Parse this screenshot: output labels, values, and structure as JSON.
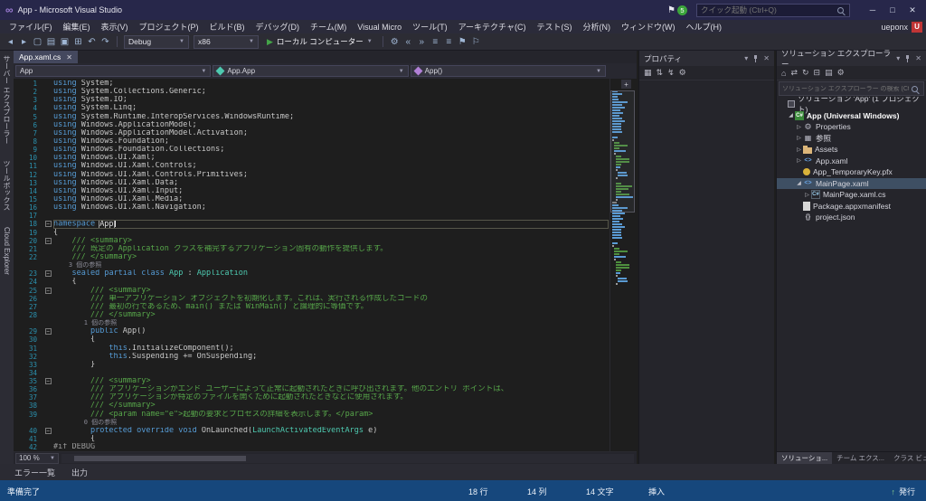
{
  "title_bar": {
    "title": "App - Microsoft Visual Studio",
    "notifications_count": "5",
    "quick_launch_placeholder": "クイック起動 (Ctrl+Q)"
  },
  "menu_bar": {
    "items": [
      "ファイル(F)",
      "編集(E)",
      "表示(V)",
      "プロジェクト(P)",
      "ビルド(B)",
      "デバッグ(D)",
      "チーム(M)",
      "Visual Micro",
      "ツール(T)",
      "アーキテクチャ(C)",
      "テスト(S)",
      "分析(N)",
      "ウィンドウ(W)",
      "ヘルプ(H)"
    ],
    "user_name": "ueponx",
    "user_avatar_letter": "U"
  },
  "toolbar": {
    "icons_left": [
      "navigate-back",
      "navigate-forward",
      "new-file",
      "open-file",
      "save",
      "save-all",
      "undo",
      "redo"
    ],
    "configuration": "Debug",
    "platform": "x86",
    "start_target": "ローカル コンピューター",
    "icons_right": [
      "gear",
      "indent-decrease",
      "indent-increase",
      "comment",
      "uncomment",
      "bookmark",
      "bookmark-clear"
    ]
  },
  "icon_glyphs": {
    "navigate-back": "◂",
    "navigate-forward": "▸",
    "new-file": "▢",
    "open-file": "▤",
    "save": "▣",
    "save-all": "⊞",
    "undo": "↶",
    "redo": "↷",
    "gear": "⚙",
    "indent-decrease": "«",
    "indent-increase": "»",
    "comment": "≡",
    "uncomment": "≡",
    "bookmark": "⚑",
    "bookmark-clear": "⚐",
    "home": "⌂",
    "sync": "⇄",
    "refresh": "↻",
    "collapse-all": "⊟",
    "show-all-files": "▤",
    "properties": "⚙",
    "categorized": "▦",
    "alphabetical": "⇅",
    "events": "↯"
  },
  "side_tabs": [
    "サーバー エクスプローラー",
    "ツールボックス",
    "Cloud Explorer"
  ],
  "editor": {
    "tab_title": "App.xaml.cs",
    "nav": {
      "project": "App",
      "type": "App.App",
      "member": "App()"
    },
    "zoom": "100 %",
    "code": [
      {
        "n": "1",
        "s": [
          [
            "k",
            "using"
          ],
          [
            "p",
            " System;"
          ]
        ]
      },
      {
        "n": "2",
        "s": [
          [
            "k",
            "using"
          ],
          [
            "p",
            " System.Collections.Generic;"
          ]
        ]
      },
      {
        "n": "3",
        "s": [
          [
            "k",
            "using"
          ],
          [
            "p",
            " System.IO;"
          ]
        ]
      },
      {
        "n": "4",
        "s": [
          [
            "k",
            "using"
          ],
          [
            "p",
            " System.Linq;"
          ]
        ]
      },
      {
        "n": "5",
        "s": [
          [
            "k",
            "using"
          ],
          [
            "p",
            " System.Runtime.InteropServices.WindowsRuntime;"
          ]
        ]
      },
      {
        "n": "6",
        "s": [
          [
            "k",
            "using"
          ],
          [
            "p",
            " Windows.ApplicationModel;"
          ]
        ]
      },
      {
        "n": "7",
        "s": [
          [
            "k",
            "using"
          ],
          [
            "p",
            " Windows.ApplicationModel.Activation;"
          ]
        ]
      },
      {
        "n": "8",
        "s": [
          [
            "k",
            "using"
          ],
          [
            "p",
            " Windows.Foundation;"
          ]
        ]
      },
      {
        "n": "9",
        "s": [
          [
            "k",
            "using"
          ],
          [
            "p",
            " Windows.Foundation.Collections;"
          ]
        ]
      },
      {
        "n": "10",
        "s": [
          [
            "k",
            "using"
          ],
          [
            "p",
            " Windows.UI.Xaml;"
          ]
        ]
      },
      {
        "n": "11",
        "s": [
          [
            "k",
            "using"
          ],
          [
            "p",
            " Windows.UI.Xaml.Controls;"
          ]
        ]
      },
      {
        "n": "12",
        "s": [
          [
            "k",
            "using"
          ],
          [
            "p",
            " Windows.UI.Xaml.Controls.Primitives;"
          ]
        ]
      },
      {
        "n": "13",
        "s": [
          [
            "k",
            "using"
          ],
          [
            "p",
            " Windows.UI.Xaml.Data;"
          ]
        ]
      },
      {
        "n": "14",
        "s": [
          [
            "k",
            "using"
          ],
          [
            "p",
            " Windows.UI.Xaml.Input;"
          ]
        ]
      },
      {
        "n": "15",
        "s": [
          [
            "k",
            "using"
          ],
          [
            "p",
            " Windows.UI.Xaml.Media;"
          ]
        ]
      },
      {
        "n": "16",
        "s": [
          [
            "k",
            "using"
          ],
          [
            "p",
            " Windows.UI.Xaml.Navigation;"
          ]
        ]
      },
      {
        "n": "17",
        "s": []
      },
      {
        "n": "18",
        "cur": 1,
        "f": 1,
        "s": [
          [
            "k",
            "namespace"
          ],
          [
            "p",
            " "
          ],
          [
            "b",
            "App"
          ]
        ]
      },
      {
        "n": "19",
        "s": [
          [
            "p",
            "{"
          ]
        ]
      },
      {
        "n": "20",
        "f": 1,
        "s": [
          [
            "c",
            "    /// <summary>"
          ]
        ]
      },
      {
        "n": "21",
        "s": [
          [
            "c",
            "    /// 既定の Application クラスを補完するアプリケーション固有の動作を提供します。"
          ]
        ]
      },
      {
        "n": "22",
        "s": [
          [
            "c",
            "    /// </summary>"
          ]
        ]
      },
      {
        "lens": "    3 個の参照"
      },
      {
        "n": "23",
        "f": 1,
        "s": [
          [
            "p",
            "    "
          ],
          [
            "k",
            "sealed"
          ],
          [
            "p",
            " "
          ],
          [
            "k",
            "partial"
          ],
          [
            "p",
            " "
          ],
          [
            "k",
            "class"
          ],
          [
            "p",
            " "
          ],
          [
            "t",
            "App"
          ],
          [
            "p",
            " : "
          ],
          [
            "t",
            "Application"
          ]
        ]
      },
      {
        "n": "24",
        "s": [
          [
            "p",
            "    {"
          ]
        ]
      },
      {
        "n": "25",
        "f": 1,
        "s": [
          [
            "c",
            "        /// <summary>"
          ]
        ]
      },
      {
        "n": "26",
        "s": [
          [
            "c",
            "        /// 単一アプリケーション オブジェクトを初期化します。これは、実行される作成したコードの"
          ]
        ]
      },
      {
        "n": "27",
        "s": [
          [
            "c",
            "        /// 最初の行であるため、main() または WinMain() と論理的に等価です。"
          ]
        ]
      },
      {
        "n": "28",
        "s": [
          [
            "c",
            "        /// </summary>"
          ]
        ]
      },
      {
        "lens": "        1 個の参照"
      },
      {
        "n": "29",
        "f": 1,
        "s": [
          [
            "p",
            "        "
          ],
          [
            "k",
            "public"
          ],
          [
            "p",
            " App()"
          ]
        ]
      },
      {
        "n": "30",
        "s": [
          [
            "p",
            "        {"
          ]
        ]
      },
      {
        "n": "31",
        "s": [
          [
            "p",
            "            "
          ],
          [
            "k",
            "this"
          ],
          [
            "p",
            ".InitializeComponent();"
          ]
        ]
      },
      {
        "n": "32",
        "s": [
          [
            "p",
            "            "
          ],
          [
            "k",
            "this"
          ],
          [
            "p",
            ".Suspending += OnSuspending;"
          ]
        ]
      },
      {
        "n": "33",
        "s": [
          [
            "p",
            "        }"
          ]
        ]
      },
      {
        "n": "34",
        "s": []
      },
      {
        "n": "35",
        "f": 1,
        "s": [
          [
            "c",
            "        /// <summary>"
          ]
        ]
      },
      {
        "n": "36",
        "s": [
          [
            "c",
            "        /// アプリケーションがエンド ユーザーによって正常に起動されたときに呼び出されます。他のエントリ ポイントは、"
          ]
        ]
      },
      {
        "n": "37",
        "s": [
          [
            "c",
            "        /// アプリケーションが特定のファイルを開くために起動されたときなどに使用されます。"
          ]
        ]
      },
      {
        "n": "38",
        "s": [
          [
            "c",
            "        /// </summary>"
          ]
        ]
      },
      {
        "n": "39",
        "s": [
          [
            "c",
            "        /// <param name=\"e\">起動の要求とプロセスの詳細を表示します。</param>"
          ]
        ]
      },
      {
        "lens": "        0 個の参照"
      },
      {
        "n": "40",
        "f": 1,
        "s": [
          [
            "p",
            "        "
          ],
          [
            "k",
            "protected"
          ],
          [
            "p",
            " "
          ],
          [
            "k",
            "override"
          ],
          [
            "p",
            " "
          ],
          [
            "k",
            "void"
          ],
          [
            "p",
            " OnLaunched("
          ],
          [
            "t",
            "LaunchActivatedEventArgs"
          ],
          [
            "p",
            " e)"
          ]
        ]
      },
      {
        "n": "41",
        "s": [
          [
            "p",
            "        {"
          ]
        ]
      },
      {
        "n": "42",
        "s": [
          [
            "g",
            "#if DEBUG"
          ]
        ]
      }
    ]
  },
  "properties_panel": {
    "title": "プロパティ",
    "toolbar_icons": [
      "categorized",
      "alphabetical",
      "events",
      "properties"
    ]
  },
  "solution_explorer": {
    "title": "ソリューション エクスプローラー",
    "toolbar_icons": [
      "home",
      "sync",
      "refresh",
      "collapse-all",
      "show-all-files",
      "properties"
    ],
    "search_placeholder": "ソリューション エクスプローラー の検索 (Ctrl+;)",
    "items": [
      {
        "label": "ソリューション 'App' (1 プロジェクト)",
        "indent": 0,
        "icon": "solution",
        "arrow": "none"
      },
      {
        "label": "App (Universal Windows)",
        "indent": 1,
        "icon": "project",
        "arrow": "open",
        "bold": true
      },
      {
        "label": "Properties",
        "indent": 2,
        "icon": "properties",
        "arrow": "closed"
      },
      {
        "label": "参照",
        "indent": 2,
        "icon": "references",
        "arrow": "closed"
      },
      {
        "label": "Assets",
        "indent": 2,
        "icon": "folder",
        "arrow": "closed"
      },
      {
        "label": "App.xaml",
        "indent": 2,
        "icon": "xaml",
        "arrow": "closed"
      },
      {
        "label": "App_TemporaryKey.pfx",
        "indent": 2,
        "icon": "certificate",
        "arrow": "none"
      },
      {
        "label": "MainPage.xaml",
        "indent": 2,
        "icon": "xaml",
        "arrow": "open",
        "selected": true
      },
      {
        "label": "MainPage.xaml.cs",
        "indent": 3,
        "icon": "csharp-file",
        "arrow": "closed"
      },
      {
        "label": "Package.appxmanifest",
        "indent": 2,
        "icon": "manifest",
        "arrow": "none"
      },
      {
        "label": "project.json",
        "indent": 2,
        "icon": "json",
        "arrow": "none"
      }
    ],
    "bottom_tabs": [
      "ソリューショ...",
      "チーム エクス...",
      "クラス ビュー"
    ]
  },
  "bottom_panel": {
    "tabs": [
      "エラー一覧",
      "出力"
    ]
  },
  "status_bar": {
    "state": "準備完了",
    "line": "18 行",
    "column": "14 列",
    "character": "14 文字",
    "mode": "挿入",
    "publish": "発行"
  }
}
